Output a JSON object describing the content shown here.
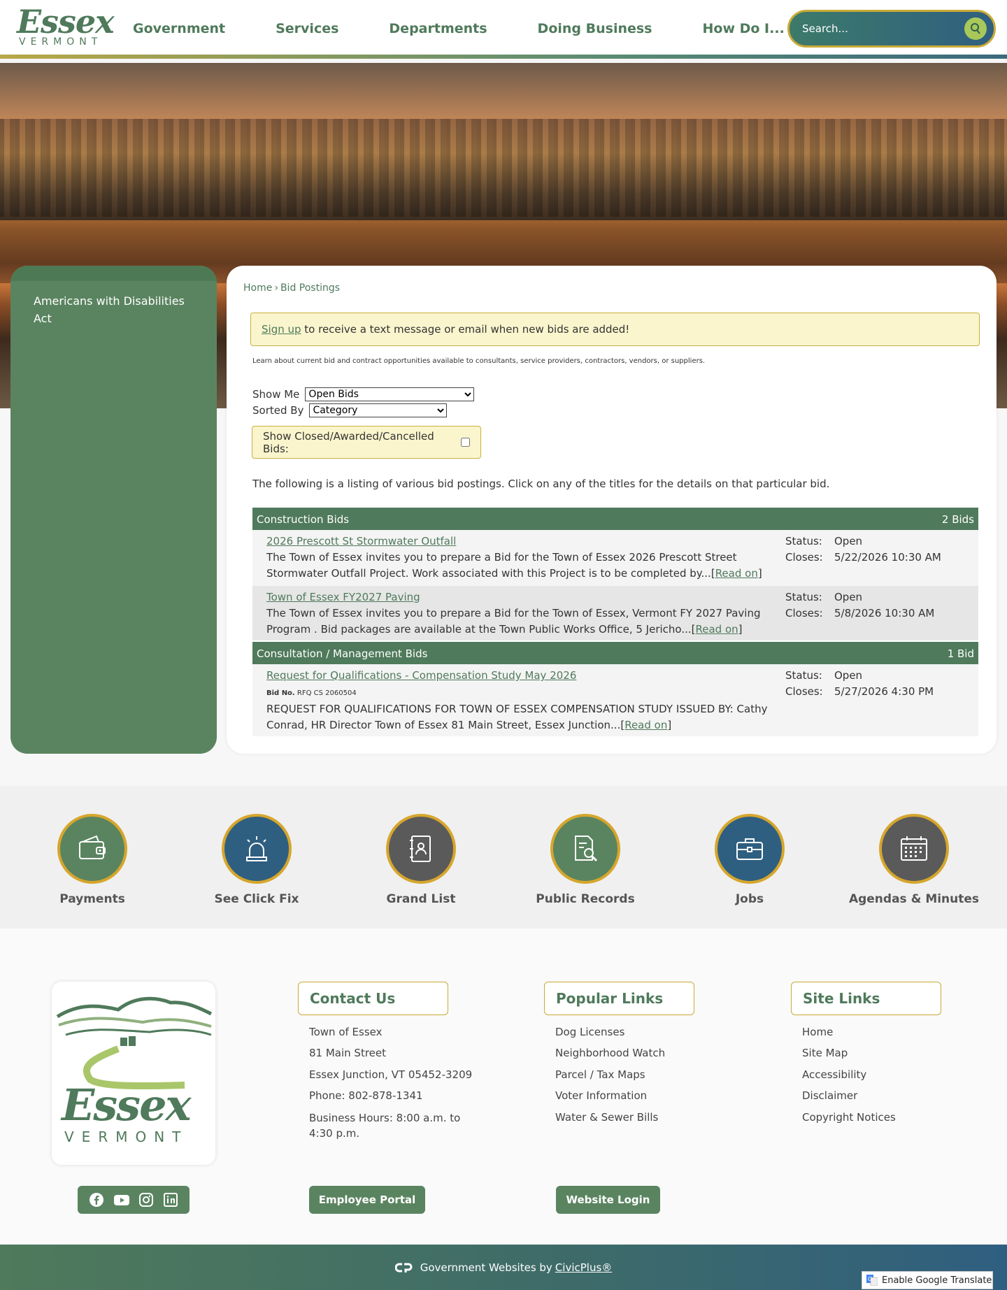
{
  "header": {
    "logo_word": "Essex",
    "logo_sub": "VERMONT",
    "nav": [
      "Government",
      "Services",
      "Departments",
      "Doing Business",
      "How Do I..."
    ],
    "search_placeholder": "Search..."
  },
  "sidebar": {
    "items": [
      "Americans with Disabilities Act"
    ]
  },
  "breadcrumb": {
    "home": "Home",
    "separator": "›",
    "current": "Bid Postings"
  },
  "alert": {
    "link": "Sign up",
    "text": " to receive a text message or email when new bids are added!"
  },
  "intro_small": "Learn about current bid and contract opportunities available to consultants, service providers, contractors, vendors, or suppliers.",
  "filters": {
    "show_me_label": "Show Me",
    "show_me_value": "Open Bids",
    "sorted_by_label": "Sorted By",
    "sorted_by_value": "Category",
    "closed_label": "Show Closed/Awarded/Cancelled Bids:"
  },
  "listing_text": "The following is a listing of various bid postings. Click on any of the titles for the details on that particular bid.",
  "categories": [
    {
      "name": "Construction Bids",
      "count": "2 Bids",
      "bids": [
        {
          "title": "2026 Prescott St Stormwater Outfall",
          "desc": "The Town of Essex invites you to prepare a Bid for the Town of Essex 2026 Prescott Street Stormwater Outfall Project. Work associated with this Project is to be completed by...",
          "read_on": "Read on",
          "status_label": "Status:",
          "status": "Open",
          "closes_label": "Closes:",
          "closes": "5/22/2026 10:30 AM"
        },
        {
          "title": "Town of Essex FY2027 Paving",
          "desc": "The Town of Essex invites you to prepare a Bid for the Town of Essex, Vermont FY 2027 Paving Program . Bid packages are available at the Town Public Works Office, 5 Jericho...",
          "read_on": "Read on",
          "status_label": "Status:",
          "status": "Open",
          "closes_label": "Closes:",
          "closes": "5/8/2026 10:30 AM"
        }
      ]
    },
    {
      "name": "Consultation / Management Bids",
      "count": "1 Bid",
      "bids": [
        {
          "title": "Request for Qualifications - Compensation Study May 2026",
          "bid_no_label": "Bid No.",
          "bid_no": "RFQ CS 2060504",
          "desc": "REQUEST FOR QUALIFICATIONS FOR TOWN OF ESSEX COMPENSATION STUDY ISSUED BY: Cathy Conrad, HR Director Town of Essex 81 Main Street, Essex Junction...",
          "read_on": "Read on",
          "status_label": "Status:",
          "status": "Open",
          "closes_label": "Closes:",
          "closes": "5/27/2026 4:30 PM"
        }
      ]
    }
  ],
  "quick_links": [
    {
      "label": "Payments",
      "icon": "wallet-icon",
      "color": "#5a8460"
    },
    {
      "label": "See Click Fix",
      "icon": "siren-icon",
      "color": "#2f5f80"
    },
    {
      "label": "Grand List",
      "icon": "address-book-icon",
      "color": "#5a5a5a"
    },
    {
      "label": "Public Records",
      "icon": "document-search-icon",
      "color": "#5a8460"
    },
    {
      "label": "Jobs",
      "icon": "briefcase-icon",
      "color": "#2f5f80"
    },
    {
      "label": "Agendas & Minutes",
      "icon": "calendar-icon",
      "color": "#5a5a5a"
    }
  ],
  "footer": {
    "logo_word": "Essex",
    "logo_sub": "VERMONT",
    "contact": {
      "heading": "Contact Us",
      "lines": [
        "Town of Essex",
        "81 Main Street",
        "Essex Junction, VT 05452-3209",
        "Phone: 802-878-1341",
        "Business Hours: 8:00 a.m. to 4:30 p.m."
      ]
    },
    "popular": {
      "heading": "Popular Links",
      "links": [
        "Dog Licenses",
        "Neighborhood Watch",
        "Parcel / Tax Maps",
        "Voter Information",
        "Water & Sewer Bills"
      ]
    },
    "site": {
      "heading": "Site Links",
      "links": [
        "Home",
        "Site Map",
        "Accessibility",
        "Disclaimer",
        "Copyright Notices"
      ]
    },
    "employee_portal": "Employee Portal",
    "website_login": "Website Login",
    "social": [
      "facebook-icon",
      "youtube-icon",
      "instagram-icon",
      "linkedin-icon"
    ]
  },
  "bottom": {
    "text": "Government Websites by",
    "link": "CivicPlus®",
    "translate": "Enable Google Translate"
  },
  "colors": {
    "primary_green": "#4f7a5b",
    "gold": "#c9aa36",
    "blue": "#2f5f80"
  }
}
